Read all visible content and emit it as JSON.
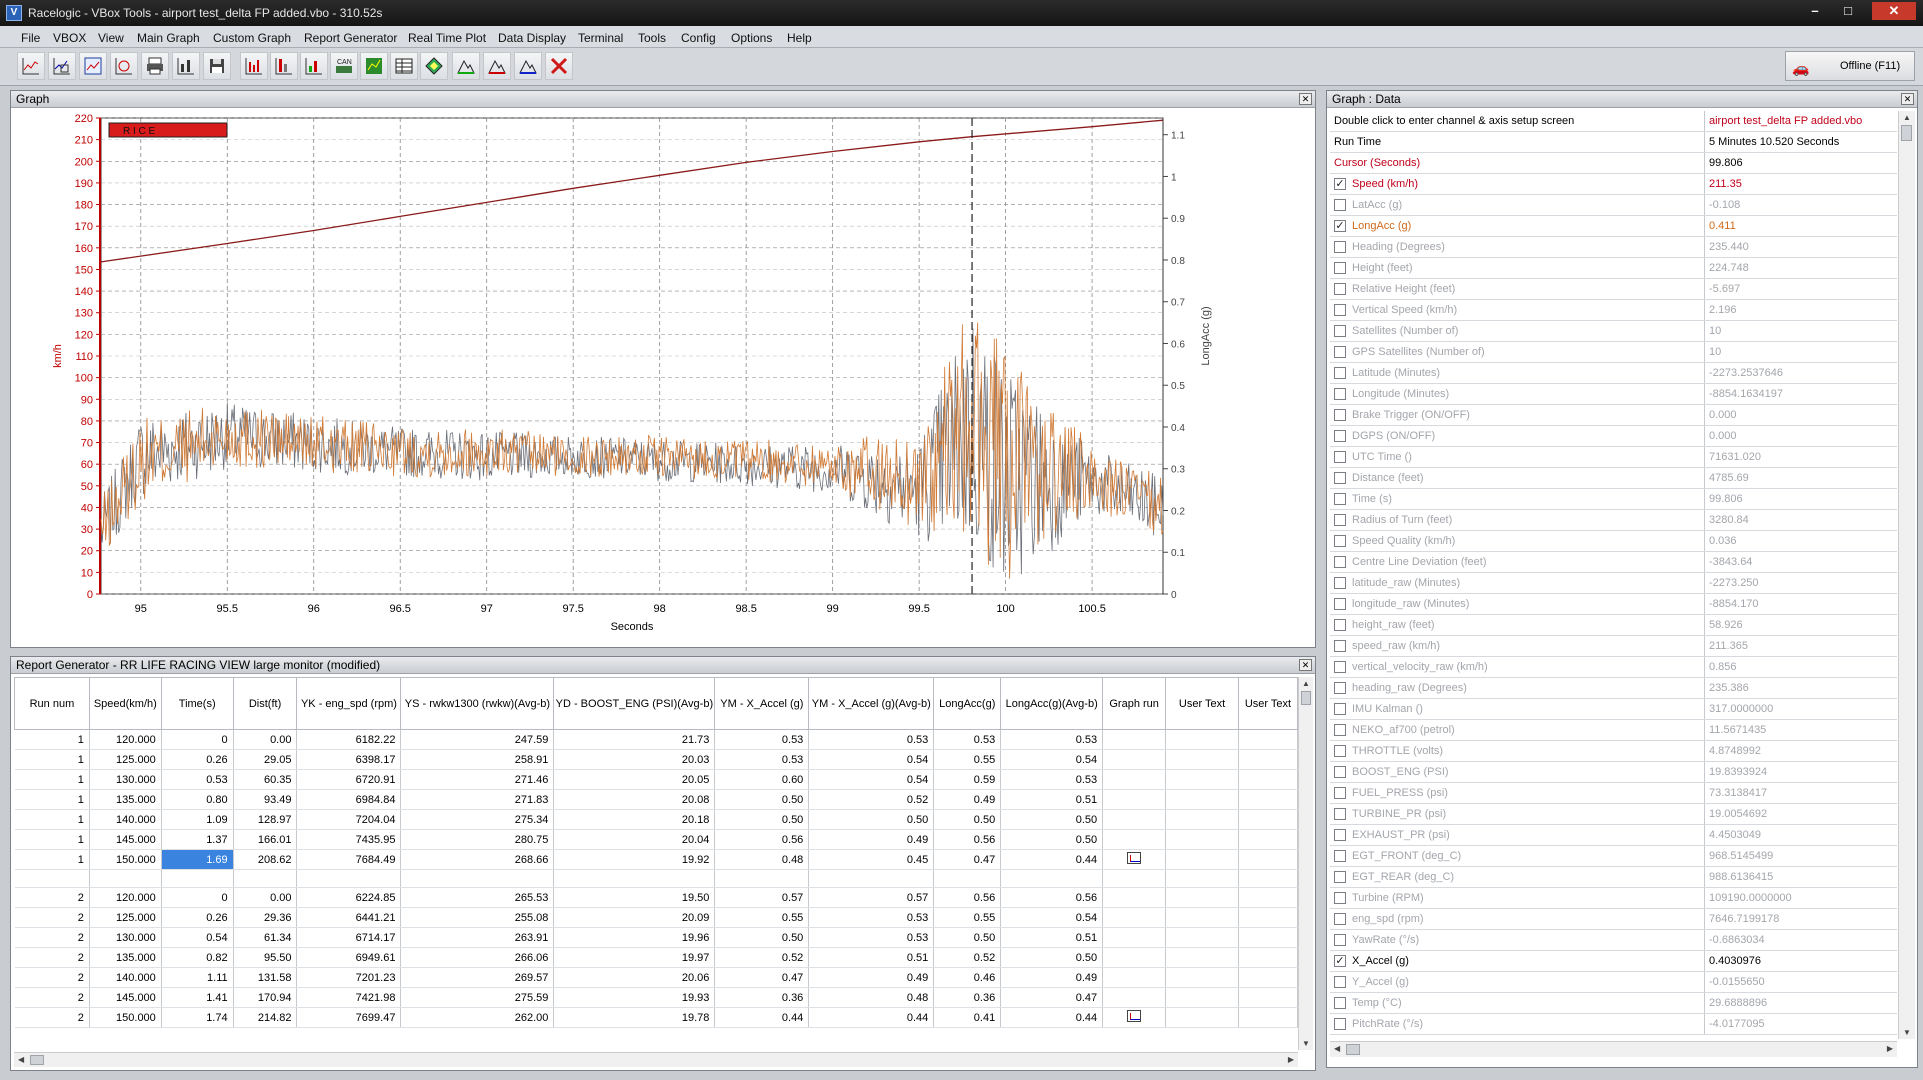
{
  "window": {
    "title": "Racelogic - VBox Tools - airport test_delta FP added.vbo - 310.52s",
    "icon_name": "vbox-app-icon",
    "minimize": "–",
    "maximize": "□",
    "close": "✕"
  },
  "menu": [
    "File",
    "VBOX",
    "View",
    "Main Graph",
    "Custom Graph",
    "Report Generator",
    "Real Time Plot",
    "Data Display",
    "Terminal",
    "Tools",
    "Config",
    "Options",
    "Help"
  ],
  "toolbar": {
    "icons": [
      "graph-icon",
      "graph-zoom-icon",
      "graph-select-icon",
      "graph-overlay-icon",
      "printer-icon",
      "scale-icon",
      "save-icon",
      "bar-graph-icon",
      "bar-graph-red-icon",
      "bar-graph-green-icon",
      "can-icon",
      "map-icon",
      "table-icon",
      "diamond-icon",
      "mountain-green-icon",
      "mountain-red-icon",
      "mountain-blue-icon",
      "delete-icon"
    ],
    "can_label": "CAN",
    "offline_label": "Offline (F11)"
  },
  "graph": {
    "title": "Graph",
    "badge": "R   I   C   E",
    "xlabel": "Seconds",
    "ylabel_left": "km/h",
    "ylabel_right": "LongAcc (g)",
    "colors": {
      "speed": "#8b1a1a",
      "longacc": "#d07a35",
      "xaccel": "#6b6f78",
      "left_axis": "#c00000",
      "grid": "#888888",
      "cursor": "#222222"
    }
  },
  "chart_data": {
    "type": "line",
    "title": "",
    "xlabel": "Seconds",
    "ylabel": "km/h",
    "xlim": [
      94.77,
      100.91
    ],
    "ylim": [
      0,
      220
    ],
    "y2label": "LongAcc (g)",
    "y2lim": [
      0,
      1.14
    ],
    "x_ticks": [
      95,
      95.5,
      96,
      96.5,
      97,
      97.5,
      98,
      98.5,
      99,
      99.5,
      100,
      100.5
    ],
    "y_ticks": [
      0,
      10,
      20,
      30,
      40,
      50,
      60,
      70,
      80,
      90,
      100,
      110,
      120,
      130,
      140,
      150,
      160,
      170,
      180,
      190,
      200,
      210,
      220
    ],
    "y2_ticks": [
      0,
      0.1,
      0.2,
      0.3,
      0.4,
      0.5,
      0.6,
      0.7,
      0.8,
      0.9,
      1,
      1.1
    ],
    "grid": true,
    "cursor_x": 99.806,
    "series": [
      {
        "name": "Speed (km/h)",
        "axis": "left",
        "x": [
          94.77,
          95.5,
          96.0,
          96.5,
          97.0,
          97.5,
          98.0,
          98.5,
          99.0,
          99.5,
          99.806,
          100.5,
          100.91
        ],
        "values": [
          153.5,
          162,
          168,
          174.5,
          181,
          187.5,
          193.5,
          199.5,
          204.5,
          209,
          211.35,
          216,
          219
        ]
      },
      {
        "name": "LongAcc (g)",
        "axis": "right",
        "x": [
          94.77,
          95.0,
          95.5,
          96.0,
          96.5,
          97.0,
          97.5,
          98.0,
          98.5,
          99.0,
          99.5,
          99.806,
          100.0,
          100.5,
          100.91
        ],
        "values": [
          0.15,
          0.32,
          0.38,
          0.36,
          0.34,
          0.34,
          0.33,
          0.33,
          0.32,
          0.31,
          0.27,
          0.411,
          0.3,
          0.28,
          0.2
        ],
        "amplitude": [
          0.08,
          0.1,
          0.08,
          0.07,
          0.06,
          0.06,
          0.05,
          0.05,
          0.05,
          0.06,
          0.12,
          0.3,
          0.28,
          0.08,
          0.08
        ]
      },
      {
        "name": "X_Accel (g)",
        "axis": "right",
        "x": [
          94.77,
          95.0,
          95.5,
          96.0,
          96.5,
          97.0,
          97.5,
          98.0,
          98.5,
          99.0,
          99.5,
          99.806,
          100.0,
          100.5,
          100.91
        ],
        "values": [
          0.15,
          0.33,
          0.38,
          0.36,
          0.34,
          0.33,
          0.33,
          0.32,
          0.31,
          0.3,
          0.25,
          0.403,
          0.28,
          0.27,
          0.2
        ],
        "amplitude": [
          0.08,
          0.1,
          0.08,
          0.07,
          0.06,
          0.06,
          0.05,
          0.05,
          0.05,
          0.06,
          0.12,
          0.3,
          0.28,
          0.08,
          0.08
        ]
      }
    ]
  },
  "report": {
    "title": "Report Generator - RR LIFE RACING VIEW large monitor (modified)",
    "columns": [
      "Run num",
      "Speed(km/h)",
      "Time(s)",
      "Dist(ft)",
      "YK - eng_spd (rpm)",
      "YS - rwkw1300 (rwkw)(Avg-b)",
      "YD - BOOST_ENG (PSI)(Avg-b)",
      "YM - X_Accel (g)",
      "YM - X_Accel (g)(Avg-b)",
      "LongAcc(g)",
      "LongAcc(g)(Avg-b)",
      "Graph run",
      "User Text",
      "User Text"
    ],
    "rows": [
      [
        "1",
        "120.000",
        "0",
        "0.00",
        "6182.22",
        "247.59",
        "21.73",
        "0.53",
        "0.53",
        "0.53",
        "0.53",
        "",
        ""
      ],
      [
        "1",
        "125.000",
        "0.26",
        "29.05",
        "6398.17",
        "258.91",
        "20.03",
        "0.53",
        "0.54",
        "0.55",
        "0.54",
        "",
        ""
      ],
      [
        "1",
        "130.000",
        "0.53",
        "60.35",
        "6720.91",
        "271.46",
        "20.05",
        "0.60",
        "0.54",
        "0.59",
        "0.53",
        "",
        ""
      ],
      [
        "1",
        "135.000",
        "0.80",
        "93.49",
        "6984.84",
        "271.83",
        "20.08",
        "0.50",
        "0.52",
        "0.49",
        "0.51",
        "",
        ""
      ],
      [
        "1",
        "140.000",
        "1.09",
        "128.97",
        "7204.04",
        "275.34",
        "20.18",
        "0.50",
        "0.50",
        "0.50",
        "0.50",
        "",
        ""
      ],
      [
        "1",
        "145.000",
        "1.37",
        "166.01",
        "7435.95",
        "280.75",
        "20.04",
        "0.56",
        "0.49",
        "0.56",
        "0.50",
        "",
        ""
      ],
      [
        "1",
        "150.000",
        "1.69",
        "208.62",
        "7684.49",
        "268.66",
        "19.92",
        "0.48",
        "0.45",
        "0.47",
        "0.44",
        "graph",
        ""
      ],
      [],
      [
        "2",
        "120.000",
        "0",
        "0.00",
        "6224.85",
        "265.53",
        "19.50",
        "0.57",
        "0.57",
        "0.56",
        "0.56",
        "",
        ""
      ],
      [
        "2",
        "125.000",
        "0.26",
        "29.36",
        "6441.21",
        "255.08",
        "20.09",
        "0.55",
        "0.53",
        "0.55",
        "0.54",
        "",
        ""
      ],
      [
        "2",
        "130.000",
        "0.54",
        "61.34",
        "6714.17",
        "263.91",
        "19.96",
        "0.50",
        "0.53",
        "0.50",
        "0.51",
        "",
        ""
      ],
      [
        "2",
        "135.000",
        "0.82",
        "95.50",
        "6949.61",
        "266.06",
        "19.97",
        "0.52",
        "0.51",
        "0.52",
        "0.50",
        "",
        ""
      ],
      [
        "2",
        "140.000",
        "1.11",
        "131.58",
        "7201.23",
        "269.57",
        "20.06",
        "0.47",
        "0.49",
        "0.46",
        "0.49",
        "",
        ""
      ],
      [
        "2",
        "145.000",
        "1.41",
        "170.94",
        "7421.98",
        "275.59",
        "19.93",
        "0.36",
        "0.48",
        "0.36",
        "0.47",
        "",
        ""
      ],
      [
        "2",
        "150.000",
        "1.74",
        "214.82",
        "7699.47",
        "262.00",
        "19.78",
        "0.44",
        "0.44",
        "0.41",
        "0.44",
        "graph",
        ""
      ]
    ],
    "selected_cell": "1.69"
  },
  "data_panel": {
    "title": "Graph : Data",
    "header": [
      {
        "name": "Double click to enter channel & axis setup screen",
        "value": "airport test_delta FP added.vbo",
        "vcolor": "red"
      },
      {
        "name": "Run Time",
        "value": "5 Minutes 10.520 Seconds",
        "vcolor": "black"
      },
      {
        "name": "Cursor (Seconds)",
        "value": "99.806",
        "ncolor": "red",
        "vcolor": "black"
      }
    ],
    "channels": [
      {
        "name": "Speed (km/h)",
        "value": "211.35",
        "checked": true,
        "color": "red"
      },
      {
        "name": "LatAcc (g)",
        "value": "-0.108",
        "checked": false,
        "color": "gray"
      },
      {
        "name": "LongAcc (g)",
        "value": "0.411",
        "checked": true,
        "color": "orange"
      },
      {
        "name": "Heading (Degrees)",
        "value": "235.440",
        "checked": false,
        "color": "gray"
      },
      {
        "name": "Height (feet)",
        "value": "224.748",
        "checked": false,
        "color": "gray"
      },
      {
        "name": "Relative Height (feet)",
        "value": "-5.697",
        "checked": false,
        "color": "gray"
      },
      {
        "name": "Vertical Speed (km/h)",
        "value": "2.196",
        "checked": false,
        "color": "gray"
      },
      {
        "name": "Satellites (Number of)",
        "value": "10",
        "checked": false,
        "color": "gray"
      },
      {
        "name": "GPS Satellites (Number of)",
        "value": "10",
        "checked": false,
        "color": "gray"
      },
      {
        "name": "Latitude (Minutes)",
        "value": "-2273.2537646",
        "checked": false,
        "color": "gray"
      },
      {
        "name": "Longitude (Minutes)",
        "value": "-8854.1634197",
        "checked": false,
        "color": "gray"
      },
      {
        "name": "Brake Trigger (ON/OFF)",
        "value": "0.000",
        "checked": false,
        "color": "gray"
      },
      {
        "name": "DGPS (ON/OFF)",
        "value": "0.000",
        "checked": false,
        "color": "gray"
      },
      {
        "name": "UTC Time ()",
        "value": "71631.020",
        "checked": false,
        "color": "gray"
      },
      {
        "name": "Distance (feet)",
        "value": "4785.69",
        "checked": false,
        "color": "gray"
      },
      {
        "name": "Time (s)",
        "value": "99.806",
        "checked": false,
        "color": "gray"
      },
      {
        "name": "Radius of Turn (feet)",
        "value": "3280.84",
        "checked": false,
        "color": "gray"
      },
      {
        "name": "Speed Quality (km/h)",
        "value": "0.036",
        "checked": false,
        "color": "gray"
      },
      {
        "name": "Centre Line Deviation (feet)",
        "value": "-3843.64",
        "checked": false,
        "color": "gray"
      },
      {
        "name": "latitude_raw (Minutes)",
        "value": "-2273.250",
        "checked": false,
        "color": "gray"
      },
      {
        "name": "longitude_raw (Minutes)",
        "value": "-8854.170",
        "checked": false,
        "color": "gray"
      },
      {
        "name": "height_raw (feet)",
        "value": "58.926",
        "checked": false,
        "color": "gray"
      },
      {
        "name": "speed_raw (km/h)",
        "value": "211.365",
        "checked": false,
        "color": "gray"
      },
      {
        "name": "vertical_velocity_raw (km/h)",
        "value": "0.856",
        "checked": false,
        "color": "gray"
      },
      {
        "name": "heading_raw (Degrees)",
        "value": "235.386",
        "checked": false,
        "color": "gray"
      },
      {
        "name": "IMU Kalman ()",
        "value": "317.0000000",
        "checked": false,
        "color": "gray"
      },
      {
        "name": "NEKO_af700 (petrol)",
        "value": "11.5671435",
        "checked": false,
        "color": "gray"
      },
      {
        "name": "THROTTLE (volts)",
        "value": "4.8748992",
        "checked": false,
        "color": "gray"
      },
      {
        "name": "BOOST_ENG (PSI)",
        "value": "19.8393924",
        "checked": false,
        "color": "gray"
      },
      {
        "name": "FUEL_PRESS (psi)",
        "value": "73.3138417",
        "checked": false,
        "color": "gray"
      },
      {
        "name": "TURBINE_PR (psi)",
        "value": "19.0054692",
        "checked": false,
        "color": "gray"
      },
      {
        "name": "EXHAUST_PR (psi)",
        "value": "4.4503049",
        "checked": false,
        "color": "gray"
      },
      {
        "name": "EGT_FRONT (deg_C)",
        "value": "968.5145499",
        "checked": false,
        "color": "gray"
      },
      {
        "name": "EGT_REAR (deg_C)",
        "value": "988.6136415",
        "checked": false,
        "color": "gray"
      },
      {
        "name": "Turbine (RPM)",
        "value": "109190.0000000",
        "checked": false,
        "color": "gray"
      },
      {
        "name": "eng_spd (rpm)",
        "value": "7646.7199178",
        "checked": false,
        "color": "gray"
      },
      {
        "name": "YawRate (°/s)",
        "value": "-0.6863034",
        "checked": false,
        "color": "gray"
      },
      {
        "name": "X_Accel (g)",
        "value": "0.4030976",
        "checked": true,
        "color": "black"
      },
      {
        "name": "Y_Accel (g)",
        "value": "-0.0155650",
        "checked": false,
        "color": "gray"
      },
      {
        "name": "Temp (°C)",
        "value": "29.6888896",
        "checked": false,
        "color": "gray"
      },
      {
        "name": "PitchRate (°/s)",
        "value": "-4.0177095",
        "checked": false,
        "color": "gray"
      }
    ]
  }
}
